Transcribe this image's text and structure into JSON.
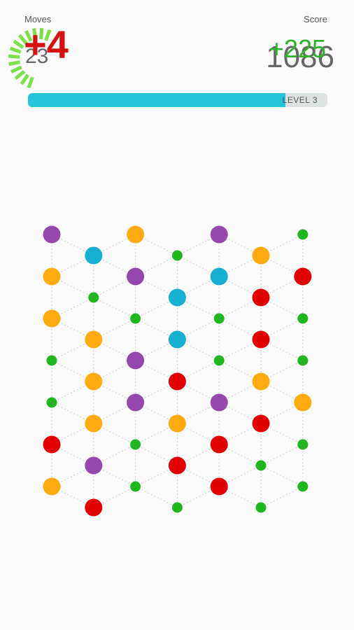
{
  "header": {
    "moves_label": "Moves",
    "moves_value": "23",
    "moves_bonus": "+4",
    "moves_progress": 0.55,
    "score_label": "Score",
    "score_value": "1086",
    "score_bonus": "+225"
  },
  "level": {
    "label": "LEVEL",
    "number": "3",
    "progress": 0.86
  },
  "colors": {
    "purple": "#9447ac",
    "orange": "#ffab0f",
    "blue": "#15afd2",
    "red": "#e00000",
    "green": "#20b620",
    "line": "#cfcfcf"
  },
  "board": {
    "columns": 7,
    "rows": 7,
    "cells": [
      [
        "purple",
        "blue",
        "orange",
        "green",
        "purple",
        "orange",
        "green"
      ],
      [
        "orange",
        "green",
        "purple",
        "blue",
        "blue",
        "red",
        "red"
      ],
      [
        "orange",
        "orange",
        "green",
        "blue",
        "green",
        "red",
        "green"
      ],
      [
        "green",
        "orange",
        "purple",
        "red",
        "green",
        "orange",
        "green"
      ],
      [
        "green",
        "orange",
        "purple",
        "orange",
        "purple",
        "red",
        "orange"
      ],
      [
        "red",
        "purple",
        "green",
        "red",
        "red",
        "green",
        "green"
      ],
      [
        "orange",
        "red",
        "green",
        "green",
        "red",
        "green",
        "green"
      ]
    ],
    "small_color": "green"
  }
}
